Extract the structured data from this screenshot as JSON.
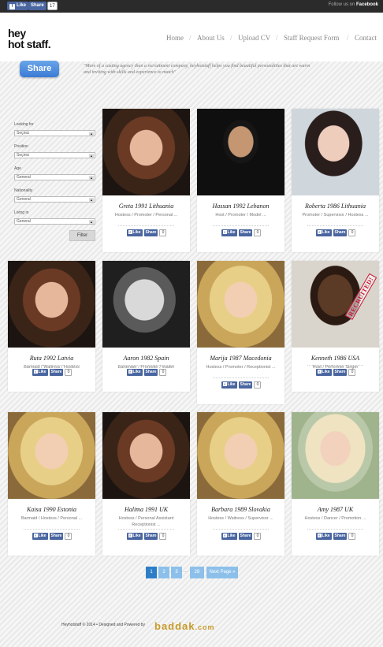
{
  "topbar": {
    "like_label": "Like",
    "share_label": "Share",
    "share_count": "17",
    "follow_prefix": "Follow us on",
    "follow_network": "Facebook"
  },
  "logo": {
    "line1": "hey",
    "line2": "hot staff."
  },
  "nav": {
    "items": [
      "Home",
      "About Us",
      "Upload CV",
      "Staff Request Form",
      "Contact"
    ],
    "separator": "/"
  },
  "share_button": "Share",
  "tagline": "\"More of a casting agency than a recruitment company, heyhotstaff helps you find beautiful personalities that are warm and inviting with skills and experience to match\"",
  "filters": {
    "fields": [
      {
        "label": "Looking for",
        "value": "Seçiniz"
      },
      {
        "label": "Position",
        "value": "Seçiniz"
      },
      {
        "label": "Age",
        "value": "General"
      },
      {
        "label": "Nationality",
        "value": "General"
      },
      {
        "label": "Living in",
        "value": "General"
      }
    ],
    "button": "Filter"
  },
  "card_labels": {
    "like": "Like",
    "share": "Share",
    "count": "0"
  },
  "profiles": [
    {
      "name": "Greta 1991 Lithuania",
      "role": "Hostess / Promoter / Personal ...",
      "photo": "woman-brunette",
      "recruited": false
    },
    {
      "name": "Hassan 1992 Lebanon",
      "role": "Host / Promoter / Model ...",
      "photo": "man-dark-hair",
      "recruited": false
    },
    {
      "name": "Roberta 1986 Lithuania",
      "role": "Promoter / Supervisor / Hostess ...",
      "photo": "woman-dark-hair",
      "recruited": false
    },
    {
      "name": "Ruta 1992 Latvia",
      "role": "Barmaid / Waitress / Hostess",
      "photo": "woman-brunette",
      "recruited": false
    },
    {
      "name": "Aaron 1982 Spain",
      "role": "Bartender / Promoter / Waiter",
      "photo": "man-bw",
      "recruited": false
    },
    {
      "name": "Marija 1987 Macedonia",
      "role": "Hostess / Promoter / Receptionist ...",
      "photo": "woman-blonde",
      "recruited": false
    },
    {
      "name": "Kenneth 1986 USA",
      "role": "Host / Performer Singer",
      "photo": "man-portrait",
      "recruited": true,
      "stamp": "RECRUITED!"
    },
    {
      "name": "Kaisa 1990 Estonia",
      "role": "Barmaid / Hostess / Personal ...",
      "photo": "woman-blonde",
      "recruited": false
    },
    {
      "name": "Halima 1991 UK",
      "role": "Hostess / Personal Assistant Receptionist ...",
      "photo": "woman-brunette",
      "recruited": false
    },
    {
      "name": "Barbara 1989 Slovakia",
      "role": "Hostess / Waitress / Supervisor ...",
      "photo": "woman-blonde",
      "recruited": false
    },
    {
      "name": "Amy 1987 UK",
      "role": "Hostess / Dancer / Promotion ...",
      "photo": "woman-blonde-floral",
      "recruited": false
    }
  ],
  "pagination": {
    "pages": [
      "1",
      "2",
      "3",
      "28"
    ],
    "dots": "...",
    "next": "Next Page »",
    "current": "1"
  },
  "footer": {
    "text": "Heyhotstaff © 2014 • Designed and Powered by",
    "brand": "baddak",
    "brand_tld": ".com"
  },
  "colors": {
    "fb_blue": "#4a66a0",
    "pager_active": "#2e7ec7",
    "pager": "#8cc0ea",
    "recruited_red": "#c8102e"
  }
}
